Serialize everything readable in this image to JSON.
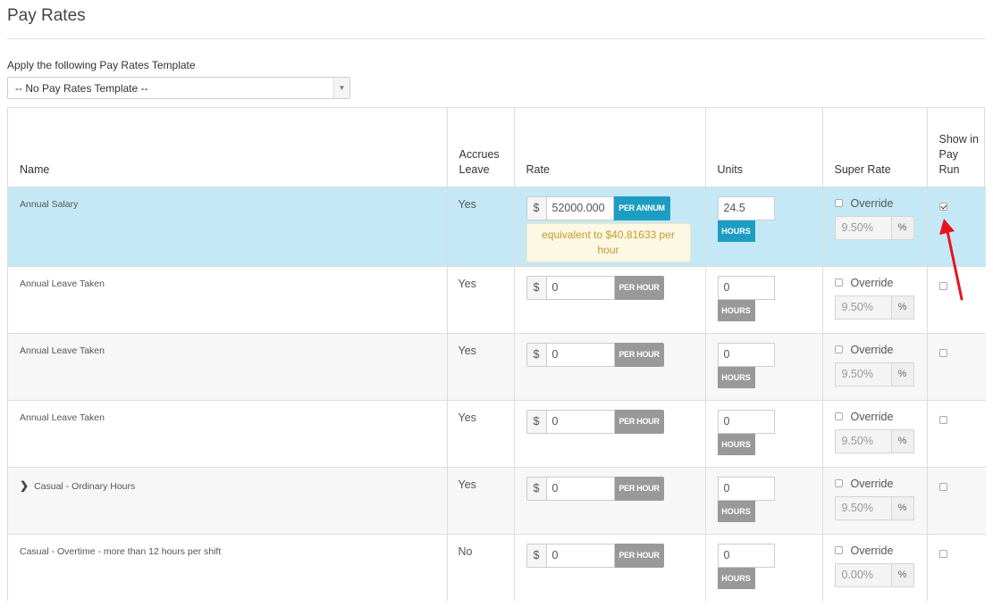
{
  "page": {
    "title": "Pay Rates",
    "template_label": "Apply the following Pay Rates Template",
    "template_value": "-- No Pay Rates Template --"
  },
  "table": {
    "headers": {
      "name": "Name",
      "accrues": "Accrues Leave",
      "rate": "Rate",
      "units": "Units",
      "super": "Super Rate",
      "show": "Show in Pay Run"
    },
    "currency": "$",
    "override_label": "Override",
    "pct": "%",
    "rows": [
      {
        "name": "Annual Salary",
        "accrues": "Yes",
        "rate": "52000.000",
        "rate_unit": "PER ANNUM",
        "equivalent": "equivalent to $40.81633 per hour",
        "units": "24.5",
        "units_label": "HOURS",
        "super_rate": "9.50%",
        "override": false,
        "show": true
      },
      {
        "name": "Annual Leave Taken",
        "accrues": "Yes",
        "rate": "0",
        "rate_unit": "PER HOUR",
        "units": "0",
        "units_label": "HOURS",
        "super_rate": "9.50%",
        "override": false,
        "show": false
      },
      {
        "name": "Annual Leave Taken",
        "accrues": "Yes",
        "rate": "0",
        "rate_unit": "PER HOUR",
        "units": "0",
        "units_label": "HOURS",
        "super_rate": "9.50%",
        "override": false,
        "show": false
      },
      {
        "name": "Annual Leave Taken",
        "accrues": "Yes",
        "rate": "0",
        "rate_unit": "PER HOUR",
        "units": "0",
        "units_label": "HOURS",
        "super_rate": "9.50%",
        "override": false,
        "show": false
      },
      {
        "name": "Casual - Ordinary Hours",
        "accrues": "Yes",
        "rate": "0",
        "rate_unit": "PER HOUR",
        "units": "0",
        "units_label": "HOURS",
        "super_rate": "9.50%",
        "override": false,
        "show": false
      },
      {
        "name": "Casual - Overtime - more than 12 hours per shift",
        "accrues": "No",
        "rate": "0",
        "rate_unit": "PER HOUR",
        "units": "0",
        "units_label": "HOURS",
        "super_rate": "0.00%",
        "override": false,
        "show": false
      }
    ]
  },
  "colors": {
    "selected_row": "#c5e8f6",
    "accent": "#1e9dc3",
    "annotation_arrow": "#e8121b"
  }
}
